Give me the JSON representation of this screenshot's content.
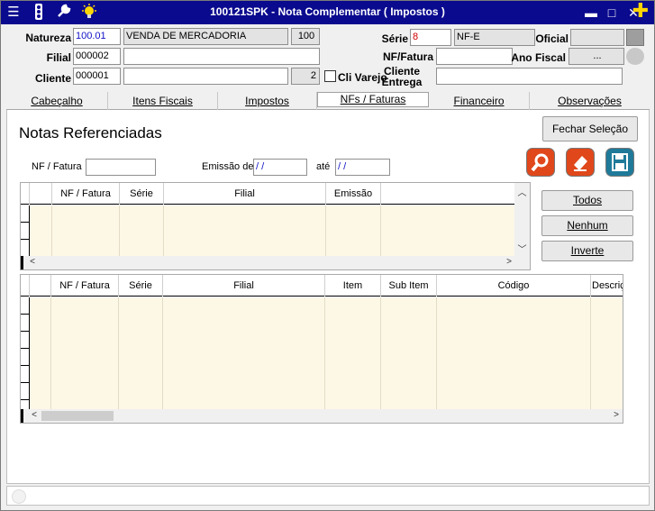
{
  "window": {
    "title": "100121SPK - Nota Complementar ( Impostos )"
  },
  "header": {
    "natureza": {
      "label": "Natureza",
      "code": "100.01",
      "desc": "VENDA DE MERCADORIA",
      "num": "100"
    },
    "filial": {
      "label": "Filial",
      "code": "000002",
      "desc": ""
    },
    "cliente": {
      "label": "Cliente",
      "code": "000001",
      "desc": "",
      "num": "2"
    },
    "cli_varejo": {
      "label": "Cli Varejo",
      "checked": false
    },
    "serie": {
      "label": "Série",
      "value": "8",
      "desc": "NF-E"
    },
    "nf_fatura": {
      "label": "NF/Fatura",
      "value": ""
    },
    "cliente_entrega": {
      "label": "Cliente Entrega",
      "value": ""
    },
    "oficial": {
      "label": "Oficial",
      "value": ""
    },
    "ano_fiscal": {
      "label": "Ano Fiscal",
      "value": "..."
    }
  },
  "tabs": [
    "Cabeçalho",
    "Itens Fiscais",
    "Impostos",
    "NFs / Faturas",
    "Financeiro",
    "Observações"
  ],
  "active_tab": "NFs / Faturas",
  "section_title": "Notas Referenciadas",
  "filters": {
    "nf_fatura_label": "NF / Fatura",
    "nf_fatura_value": "",
    "emissao_de_label": "Emissão de",
    "emissao_de_value": " / /",
    "ate_label": "até",
    "ate_value": " / /"
  },
  "buttons": {
    "fechar_selecao": "Fechar Seleção",
    "todos": "Todos",
    "nenhum": "Nenhum",
    "inverte": "Inverte"
  },
  "grid_top": {
    "columns": [
      "NF / Fatura",
      "Série",
      "Filial",
      "Emissão"
    ]
  },
  "grid_bottom": {
    "columns": [
      "NF / Fatura",
      "Série",
      "Filial",
      "Item",
      "Sub Item",
      "Código",
      "Descriç"
    ]
  },
  "colors": {
    "title_bar": "#0a0a8f",
    "grid_body": "#fdf7e6",
    "icon_orange": "#e0471b",
    "icon_teal": "#1f7a9a"
  }
}
